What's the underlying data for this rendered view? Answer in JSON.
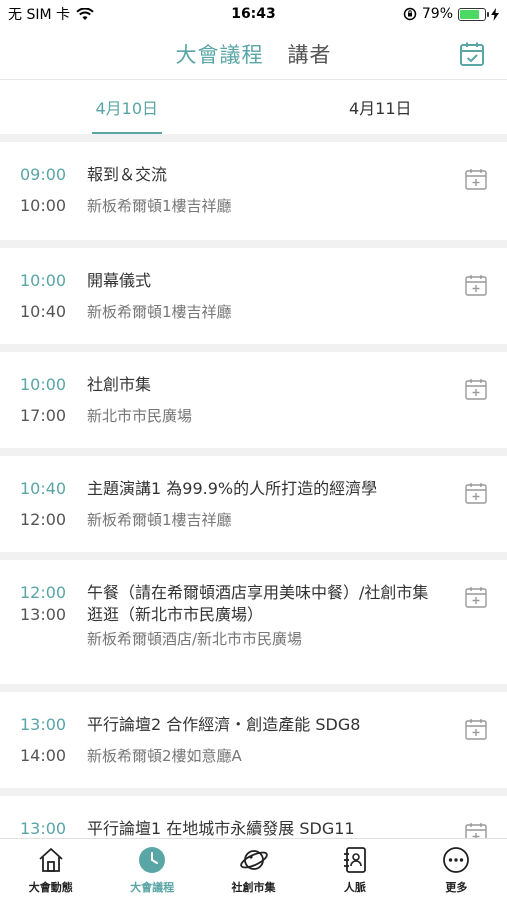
{
  "status_bar": {
    "carrier": "无 SIM 卡",
    "time": "16:43",
    "battery": "79%",
    "battery_level": 0.79
  },
  "header": {
    "tabs": [
      {
        "label": "大會議程",
        "active": true
      },
      {
        "label": "講者",
        "active": false
      }
    ],
    "calendar_icon": "calendar-check-icon"
  },
  "date_tabs": [
    {
      "label": "4月10日",
      "active": true
    },
    {
      "label": "4月11日",
      "active": false
    }
  ],
  "agenda": [
    {
      "start": "09:00",
      "end": "10:00",
      "title": "報到＆交流",
      "location": "新板希爾頓1樓吉祥廳"
    },
    {
      "start": "10:00",
      "end": "10:40",
      "title": "開幕儀式",
      "location": "新板希爾頓1樓吉祥廳"
    },
    {
      "start": "10:00",
      "end": "17:00",
      "title": "社創市集",
      "location": "新北市市民廣場"
    },
    {
      "start": "10:40",
      "end": "12:00",
      "title": "主題演講1 為99.9%的人所打造的經濟學",
      "location": "新板希爾頓1樓吉祥廳"
    },
    {
      "start": "12:00",
      "end": "13:00",
      "title": "午餐（請在希爾頓酒店享用美味中餐）/社創市集逛逛（新北市市民廣場）",
      "location": "新板希爾頓酒店/新北市市民廣場"
    },
    {
      "start": "13:00",
      "end": "14:00",
      "title": "平行論壇2 合作經濟・創造產能 SDG8",
      "location": "新板希爾頓2樓如意廳A"
    },
    {
      "start": "13:00",
      "end": "",
      "title": "平行論壇1 在地城市永續發展 SDG11",
      "location": ""
    }
  ],
  "bottom_nav": [
    {
      "label": "大會動態",
      "icon": "home-icon",
      "active": false
    },
    {
      "label": "大會議程",
      "icon": "clock-icon",
      "active": true
    },
    {
      "label": "社創市集",
      "icon": "planet-icon",
      "active": false
    },
    {
      "label": "人脈",
      "icon": "contacts-icon",
      "active": false
    },
    {
      "label": "更多",
      "icon": "more-icon",
      "active": false
    }
  ],
  "colors": {
    "accent": "#5aa5a6",
    "battery_green": "#4cd964"
  }
}
